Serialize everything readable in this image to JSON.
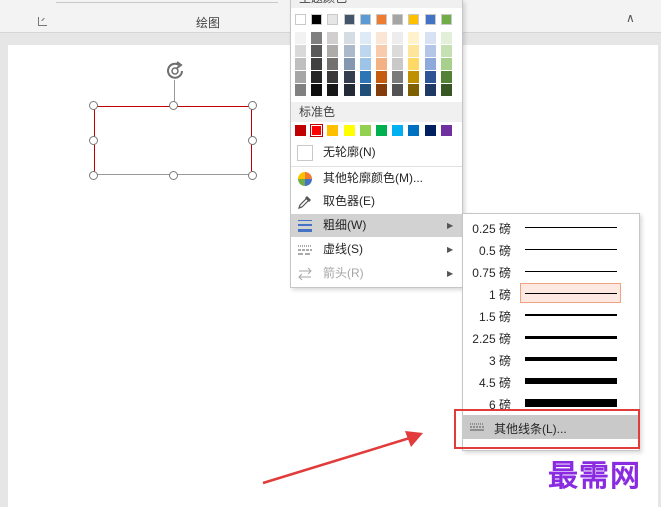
{
  "ribbon": {
    "group_label": "绘图"
  },
  "menu": {
    "theme_header": "主题颜色",
    "theme_colors": [
      "#ffffff",
      "#000000",
      "#e7e6e6",
      "#44546a",
      "#5b9bd5",
      "#ed7d31",
      "#a5a5a5",
      "#ffc000",
      "#4472c4",
      "#70ad47"
    ],
    "theme_shades": [
      [
        "#f2f2f2",
        "#d9d9d9",
        "#bfbfbf",
        "#a6a6a6",
        "#808080"
      ],
      [
        "#7f7f7f",
        "#595959",
        "#404040",
        "#262626",
        "#0d0d0d"
      ],
      [
        "#d0cece",
        "#aeabab",
        "#757171",
        "#3a3838",
        "#171616"
      ],
      [
        "#d6dce4",
        "#acb9ca",
        "#8497b0",
        "#333f4f",
        "#222a35"
      ],
      [
        "#deebf6",
        "#bdd7ee",
        "#9dc3e6",
        "#2e75b5",
        "#1f4e79"
      ],
      [
        "#fbe5d5",
        "#f7cbac",
        "#f4b183",
        "#c55a11",
        "#833c0b"
      ],
      [
        "#ededed",
        "#dbdbdb",
        "#c9c9c9",
        "#7b7b7b",
        "#525252"
      ],
      [
        "#fff2cc",
        "#fee599",
        "#ffd966",
        "#bf9000",
        "#7f6000"
      ],
      [
        "#d9e2f3",
        "#b4c6e7",
        "#8eaadb",
        "#2f5496",
        "#1f3864"
      ],
      [
        "#e2efd9",
        "#c5e0b3",
        "#a8d08d",
        "#538135",
        "#375623"
      ]
    ],
    "standard_header": "标准色",
    "standard_colors": [
      "#c00000",
      "#ff0000",
      "#ffc000",
      "#ffff00",
      "#92d050",
      "#00b050",
      "#00b0f0",
      "#0070c0",
      "#002060",
      "#7030a0"
    ],
    "selected_standard_color": "#ff0000",
    "items": {
      "no_outline": "无轮廓(N)",
      "more_colors": "其他轮廓颜色(M)...",
      "eyedropper": "取色器(E)",
      "weight": "粗细(W)",
      "dashes": "虚线(S)",
      "arrows": "箭头(R)"
    }
  },
  "weight_submenu": {
    "options": [
      {
        "label": "0.25 磅",
        "weight_pt": 0.25
      },
      {
        "label": "0.5 磅",
        "weight_pt": 0.5
      },
      {
        "label": "0.75 磅",
        "weight_pt": 0.75
      },
      {
        "label": "1 磅",
        "weight_pt": 1,
        "selected": true
      },
      {
        "label": "1.5 磅",
        "weight_pt": 1.5
      },
      {
        "label": "2.25 磅",
        "weight_pt": 2.25
      },
      {
        "label": "3 磅",
        "weight_pt": 3
      },
      {
        "label": "4.5 磅",
        "weight_pt": 4.5
      },
      {
        "label": "6 磅",
        "weight_pt": 6
      }
    ],
    "more_lines": "其他线条(L)..."
  },
  "accent_color": "#e23b3b",
  "watermark": "最需网"
}
